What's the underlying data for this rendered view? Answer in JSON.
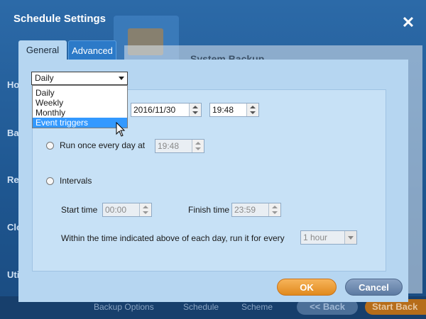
{
  "dialog": {
    "title": "Schedule Settings",
    "close_glyph": "✕"
  },
  "tabs": [
    {
      "label": "General",
      "active": true
    },
    {
      "label": "Advanced",
      "active": false
    }
  ],
  "schedule_type": {
    "selected": "Daily",
    "options": [
      "Daily",
      "Weekly",
      "Monthly",
      "Event triggers"
    ],
    "highlighted_option": "Event triggers"
  },
  "start_date": {
    "value": "2016/11/30",
    "time": "19:48"
  },
  "run_once": {
    "label": "Run once every day at",
    "time": "19:48"
  },
  "intervals": {
    "label": "Intervals",
    "start_label": "Start time",
    "start_value": "00:00",
    "finish_label": "Finish time",
    "finish_value": "23:59",
    "within_label": "Within the time indicated above of each day, run it for every",
    "every_value": "1 hour"
  },
  "buttons": {
    "ok": "OK",
    "cancel": "Cancel"
  },
  "background_app": {
    "title": "System Backup",
    "sidebar": [
      "Ho",
      "Ba",
      "Re",
      "Clo",
      "Uti"
    ],
    "bottom_items": [
      "Backup Options",
      "Schedule",
      "Scheme"
    ],
    "back_label": "<< Back",
    "start_label": "Start Back"
  },
  "colors": {
    "accent": "#2c7ac8",
    "ok": "#e08a1e",
    "cancel": "#5c7aa2",
    "selection": "#3399ff"
  }
}
